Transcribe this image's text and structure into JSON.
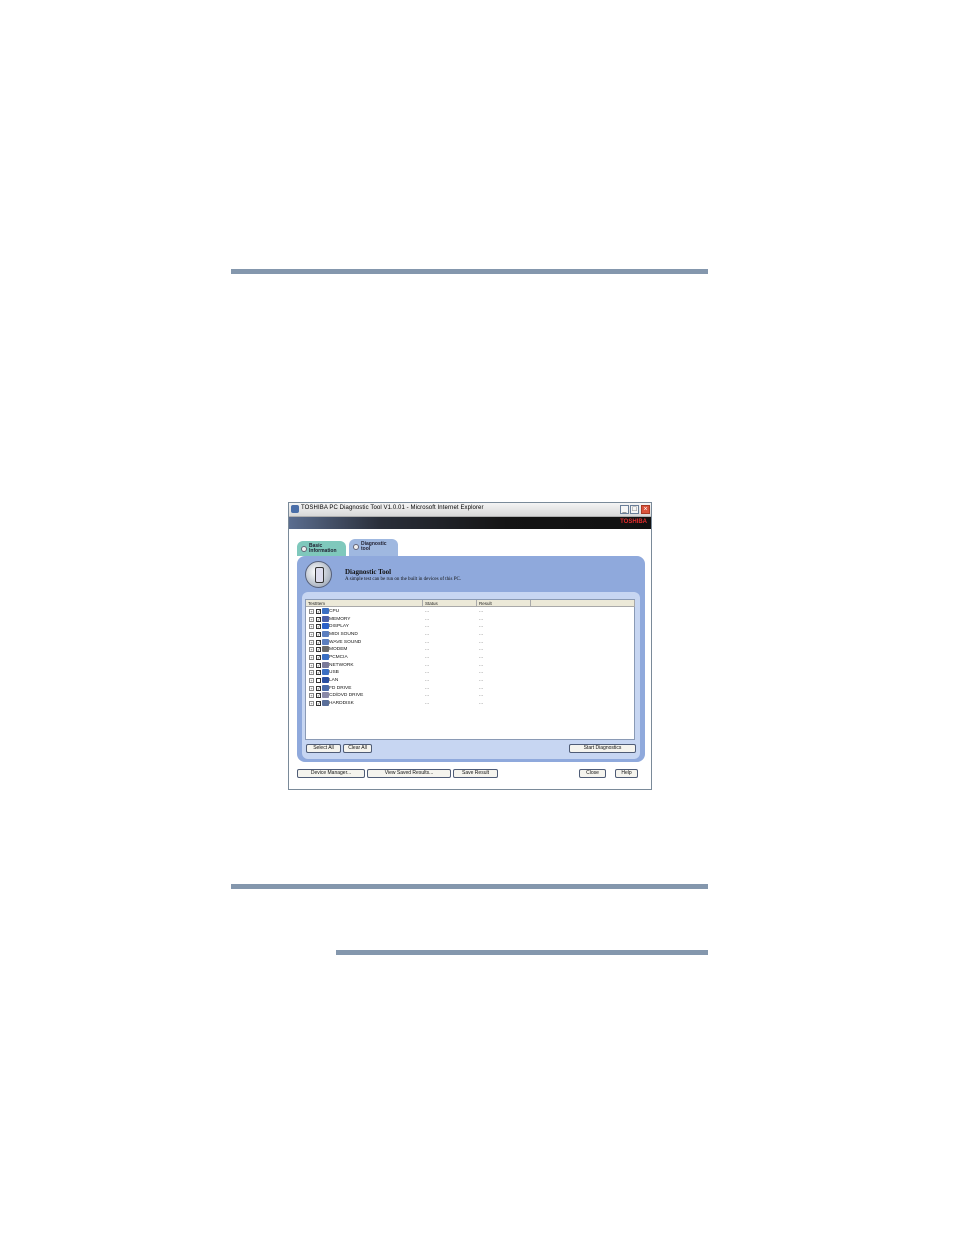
{
  "window": {
    "title": "TOSHIBA PC Diagnostic Tool V1.0.01 - Microsoft Internet Explorer",
    "brand": "TOSHIBA",
    "controls": {
      "minimize": "_",
      "maximize": "□",
      "close": "×"
    }
  },
  "tabs": [
    {
      "label": "Basic Information"
    },
    {
      "label": "Diagnostic tool"
    }
  ],
  "panel": {
    "title": "Diagnostic Tool",
    "description": "A simple test can be run on the built in devices of this PC."
  },
  "list": {
    "columns": [
      "TestItem",
      "Status",
      "Result",
      ""
    ],
    "rows": [
      {
        "name": "CPU",
        "checked": true,
        "status": "...",
        "result": "...",
        "color": "#3b6fc2"
      },
      {
        "name": "MEMORY",
        "checked": true,
        "status": "...",
        "result": "...",
        "color": "#4a5fa8"
      },
      {
        "name": "DISPLAY",
        "checked": true,
        "status": "...",
        "result": "...",
        "color": "#2e62c8"
      },
      {
        "name": "MIDI SOUND",
        "checked": true,
        "status": "...",
        "result": "...",
        "color": "#5c7fbf"
      },
      {
        "name": "WAVE SOUND",
        "checked": true,
        "status": "...",
        "result": "...",
        "color": "#5c7fbf"
      },
      {
        "name": "MODEM",
        "checked": true,
        "status": "...",
        "result": "...",
        "color": "#6a6a6a"
      },
      {
        "name": "PCMCIA",
        "checked": true,
        "status": "...",
        "result": "...",
        "color": "#3b6fc2"
      },
      {
        "name": "NETWORK",
        "checked": true,
        "status": "...",
        "result": "...",
        "color": "#7a7a9a"
      },
      {
        "name": "USB",
        "checked": true,
        "status": "...",
        "result": "...",
        "color": "#3b6fc2"
      },
      {
        "name": "LAN",
        "checked": false,
        "status": "...",
        "result": "...",
        "color": "#2a4fa0"
      },
      {
        "name": "FD DRIVE",
        "checked": true,
        "status": "...",
        "result": "...",
        "color": "#4a6aa8"
      },
      {
        "name": "CD/DVD DRIVE",
        "checked": true,
        "status": "...",
        "result": "...",
        "color": "#8a8aa8"
      },
      {
        "name": "HARDDISK",
        "checked": true,
        "status": "...",
        "result": "...",
        "color": "#5a6f9a"
      }
    ]
  },
  "buttons": {
    "select_all": "Select All",
    "clear_all": "Clear All",
    "start_diagnostics": "Start Diagnostics",
    "device_manager": "Device Manager...",
    "view_saved_results": "View Saved Results...",
    "save_result": "Save Result",
    "close": "Close",
    "help": "Help"
  }
}
